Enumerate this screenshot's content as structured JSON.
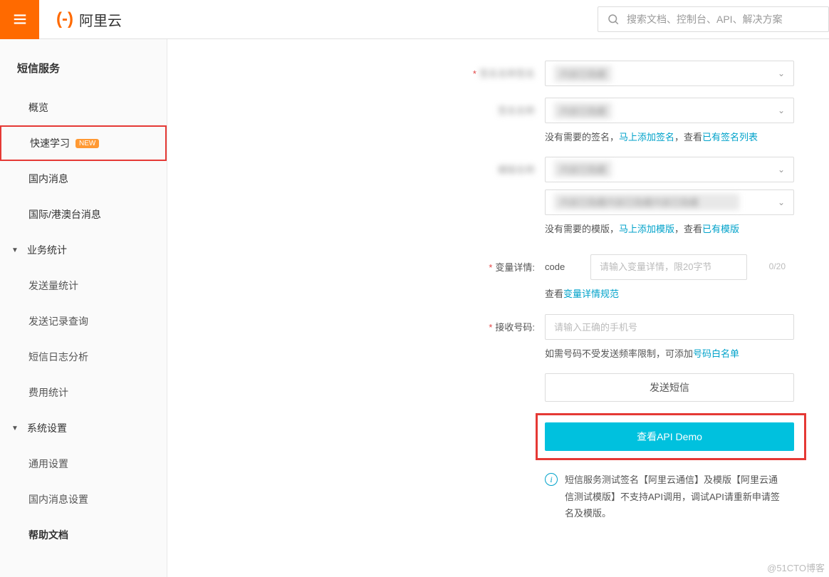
{
  "header": {
    "logo_text": "阿里云",
    "search_placeholder": "搜索文档、控制台、API、解决方案"
  },
  "sidebar": {
    "title": "短信服务",
    "items": [
      {
        "label": "概览"
      },
      {
        "label": "快速学习",
        "badge": "NEW",
        "highlighted": true
      },
      {
        "label": "国内消息"
      },
      {
        "label": "国际/港澳台消息"
      }
    ],
    "groups": [
      {
        "label": "业务统计",
        "children": [
          {
            "label": "发送量统计"
          },
          {
            "label": "发送记录查询"
          },
          {
            "label": "短信日志分析"
          },
          {
            "label": "费用统计"
          }
        ]
      },
      {
        "label": "系统设置",
        "children": [
          {
            "label": "通用设置"
          },
          {
            "label": "国内消息设置"
          }
        ]
      }
    ],
    "footer_item": {
      "label": "帮助文档"
    }
  },
  "form": {
    "signature_helper_prefix": "没有需要的签名，",
    "signature_link_add": "马上添加签名",
    "signature_helper_mid": "，查看",
    "signature_link_list": "已有签名列表",
    "template_helper_prefix": "没有需要的模版，",
    "template_link_add": "马上添加模版",
    "template_helper_mid": "，查看",
    "template_link_list": "已有模版",
    "var_label": "变量详情:",
    "var_code_label": "code",
    "var_placeholder": "请输入变量详情，限20字节内",
    "var_count": "0/20",
    "var_helper_prefix": "查看",
    "var_helper_link": "变量详情规范",
    "phone_label": "接收号码:",
    "phone_placeholder": "请输入正确的手机号",
    "phone_helper_prefix": "如需号码不受发送频率限制，可添加",
    "phone_helper_link": "号码白名单",
    "send_btn": "发送短信",
    "api_demo_btn": "查看API Demo",
    "info_text": "短信服务测试签名【阿里云通信】及模版【阿里云通信测试模版】不支持API调用，调试API请重新申请签名及模版。"
  },
  "watermark": "@51CTO博客"
}
